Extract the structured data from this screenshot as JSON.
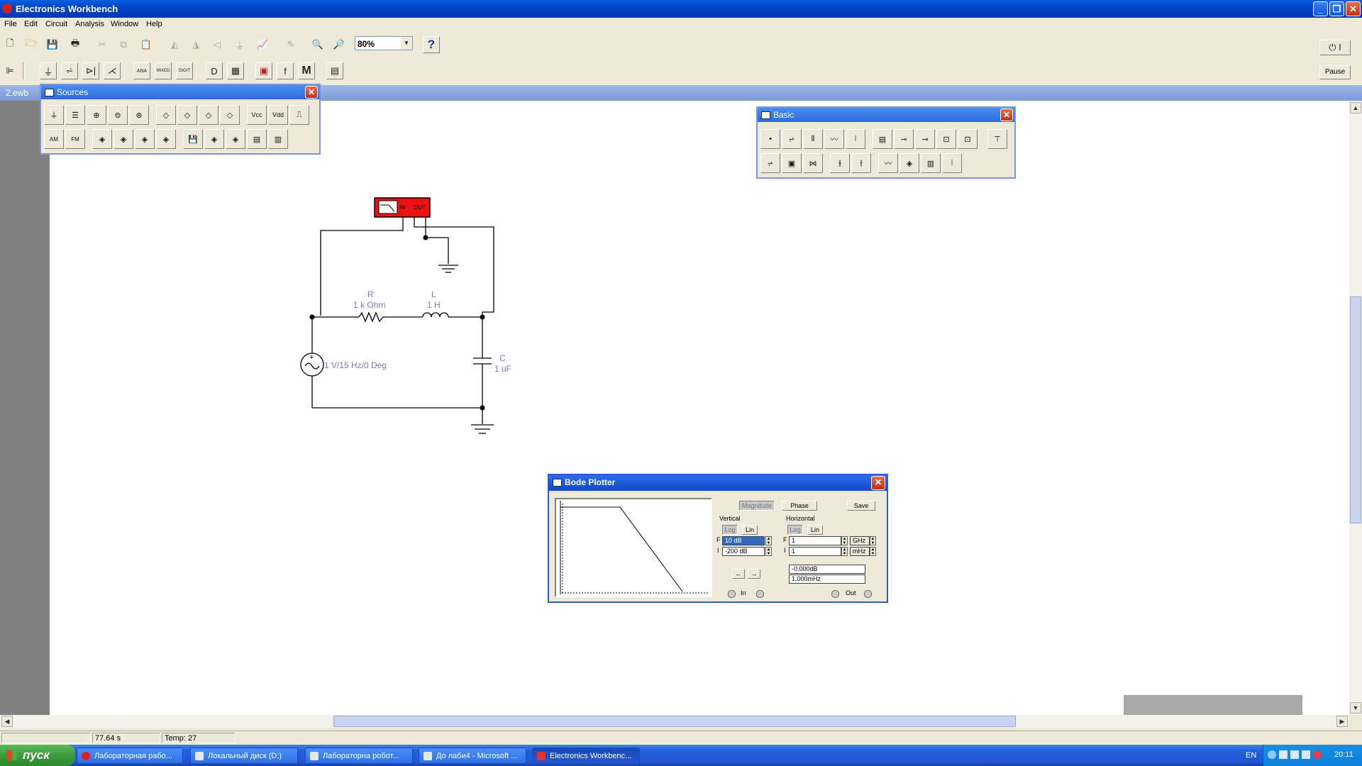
{
  "window": {
    "title": "Electronics Workbench"
  },
  "menu": [
    "File",
    "Edit",
    "Circuit",
    "Analysis",
    "Window",
    "Help"
  ],
  "toolbar": {
    "zoom": "80%",
    "help": "?",
    "pause_label": "Pause"
  },
  "parts_bin_labels": {
    "analog": "ANA",
    "mixed": "MIXED",
    "digital": "DIGIT",
    "misc": "M"
  },
  "document": {
    "tab": "2.ewb"
  },
  "sources_palette": {
    "title": "Sources",
    "vcc": "Vcc",
    "vdd": "Vdd",
    "am": "AM",
    "fm": "FM"
  },
  "basic_palette": {
    "title": "Basic"
  },
  "circuit": {
    "bode_in": "IN",
    "bode_out": "OUT",
    "r_name": "R",
    "r_value": "1 k Ohm",
    "l_name": "L",
    "l_value": "1 H",
    "c_name": "C",
    "c_value": "1 uF",
    "source_label": "1 V/15 Hz/0 Deg"
  },
  "bode": {
    "title": "Bode Plotter",
    "magnitude": "Magnitude",
    "phase": "Phase",
    "save": "Save",
    "vertical": "Vertical",
    "horizontal": "Horizontal",
    "log": "Log",
    "lin": "Lin",
    "v_final": "10 dB",
    "v_initial": "-200 dB",
    "h_final": "1",
    "h_initial": "1",
    "h_final_unit": "GHz",
    "h_initial_unit": "mHz",
    "readout_db": "-0.000dB",
    "readout_freq": "1.000mHz",
    "f_label": "F",
    "i_label": "I",
    "in_label": "In",
    "out_label": "Out"
  },
  "status": {
    "time": "77.64 s",
    "temp": "Temp:  27"
  },
  "taskbar": {
    "start": "пуск",
    "tasks": [
      "Лабораторная рабо...",
      "Локальный диск (D:)",
      "Лабораторна робот...",
      "До лаби4 - Microsoft ...",
      "Electronics Workbenc..."
    ],
    "lang": "EN",
    "clock": "20:11"
  }
}
